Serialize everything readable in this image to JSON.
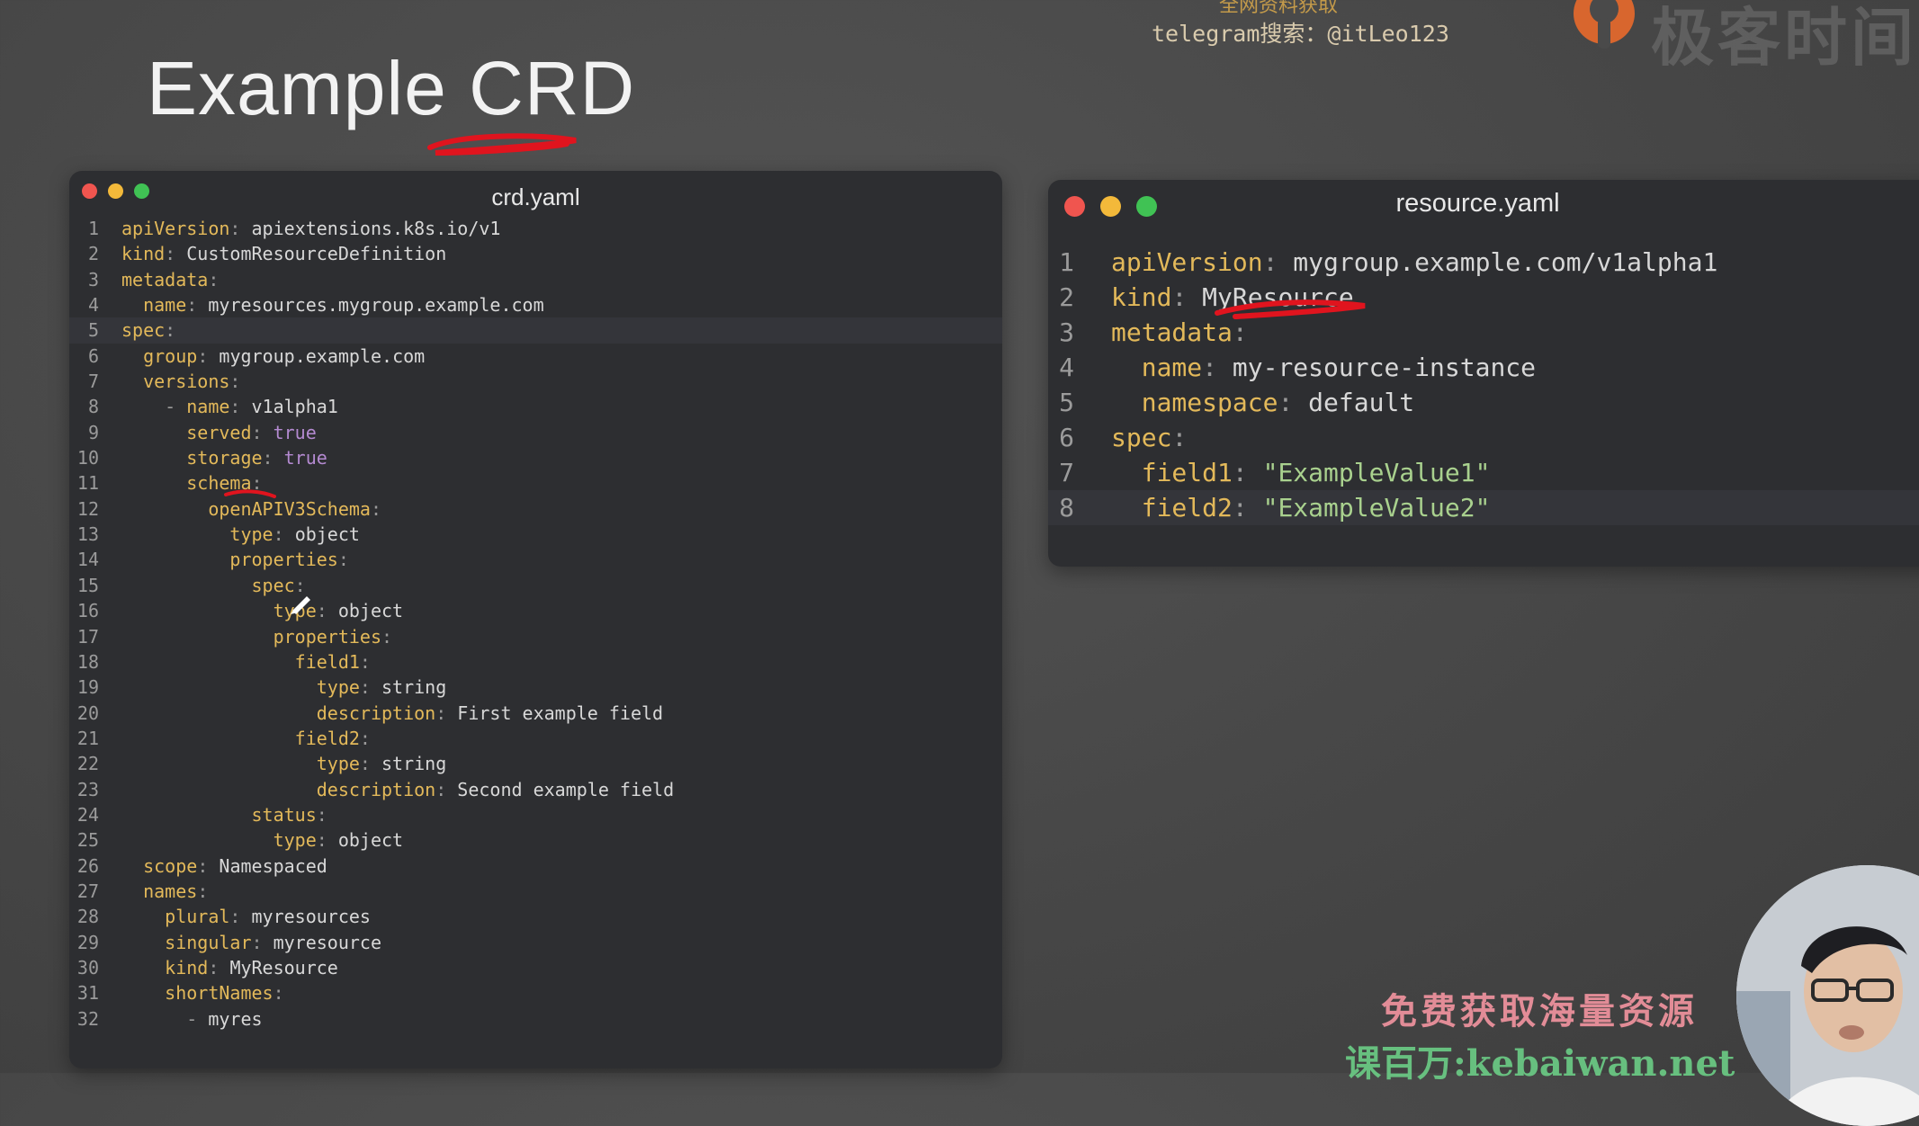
{
  "slide": {
    "title": "Example CRD"
  },
  "watermark": {
    "top_cut": "全网资料获取",
    "telegram": "telegram搜索：@itLeo123",
    "logo_text": "极客时间"
  },
  "left_window": {
    "title": "crd.yaml",
    "lines": [
      {
        "n": "1",
        "i": "",
        "k": "apiVersion",
        "v": "apiextensions.k8s.io/v1",
        "t": "v"
      },
      {
        "n": "2",
        "i": "",
        "k": "kind",
        "v": "CustomResourceDefinition",
        "t": "v"
      },
      {
        "n": "3",
        "i": "",
        "k": "metadata",
        "v": "",
        "t": "v"
      },
      {
        "n": "4",
        "i": "  ",
        "k": "name",
        "v": "myresources.mygroup.example.com",
        "t": "v"
      },
      {
        "n": "5",
        "i": "",
        "k": "spec",
        "v": "",
        "t": "v",
        "hl": true
      },
      {
        "n": "6",
        "i": "  ",
        "k": "group",
        "v": "mygroup.example.com",
        "t": "v"
      },
      {
        "n": "7",
        "i": "  ",
        "k": "versions",
        "v": "",
        "t": "v"
      },
      {
        "n": "8",
        "i": "    - ",
        "k": "name",
        "v": "v1alpha1",
        "t": "v"
      },
      {
        "n": "9",
        "i": "      ",
        "k": "served",
        "v": "true",
        "t": "b"
      },
      {
        "n": "10",
        "i": "      ",
        "k": "storage",
        "v": "true",
        "t": "b"
      },
      {
        "n": "11",
        "i": "      ",
        "k": "schema",
        "v": "",
        "t": "v"
      },
      {
        "n": "12",
        "i": "        ",
        "k": "openAPIV3Schema",
        "v": "",
        "t": "v"
      },
      {
        "n": "13",
        "i": "          ",
        "k": "type",
        "v": "object",
        "t": "v"
      },
      {
        "n": "14",
        "i": "          ",
        "k": "properties",
        "v": "",
        "t": "v"
      },
      {
        "n": "15",
        "i": "            ",
        "k": "spec",
        "v": "",
        "t": "v"
      },
      {
        "n": "16",
        "i": "              ",
        "k": "type",
        "v": "object",
        "t": "v"
      },
      {
        "n": "17",
        "i": "              ",
        "k": "properties",
        "v": "",
        "t": "v"
      },
      {
        "n": "18",
        "i": "                ",
        "k": "field1",
        "v": "",
        "t": "v"
      },
      {
        "n": "19",
        "i": "                  ",
        "k": "type",
        "v": "string",
        "t": "v"
      },
      {
        "n": "20",
        "i": "                  ",
        "k": "description",
        "v": "First example field",
        "t": "v"
      },
      {
        "n": "21",
        "i": "                ",
        "k": "field2",
        "v": "",
        "t": "v"
      },
      {
        "n": "22",
        "i": "                  ",
        "k": "type",
        "v": "string",
        "t": "v"
      },
      {
        "n": "23",
        "i": "                  ",
        "k": "description",
        "v": "Second example field",
        "t": "v"
      },
      {
        "n": "24",
        "i": "            ",
        "k": "status",
        "v": "",
        "t": "v"
      },
      {
        "n": "25",
        "i": "              ",
        "k": "type",
        "v": "object",
        "t": "v"
      },
      {
        "n": "26",
        "i": "  ",
        "k": "scope",
        "v": "Namespaced",
        "t": "v"
      },
      {
        "n": "27",
        "i": "  ",
        "k": "names",
        "v": "",
        "t": "v"
      },
      {
        "n": "28",
        "i": "    ",
        "k": "plural",
        "v": "myresources",
        "t": "v"
      },
      {
        "n": "29",
        "i": "    ",
        "k": "singular",
        "v": "myresource",
        "t": "v"
      },
      {
        "n": "30",
        "i": "    ",
        "k": "kind",
        "v": "MyResource",
        "t": "v"
      },
      {
        "n": "31",
        "i": "    ",
        "k": "shortNames",
        "v": "",
        "t": "v"
      },
      {
        "n": "32",
        "i": "      - ",
        "k": "",
        "v": "myres",
        "t": "v"
      }
    ]
  },
  "right_window": {
    "title": "resource.yaml",
    "lines": [
      {
        "n": "1",
        "i": "",
        "k": "apiVersion",
        "v": "mygroup.example.com/v1alpha1",
        "t": "v"
      },
      {
        "n": "2",
        "i": "",
        "k": "kind",
        "v": "MyResource",
        "t": "v"
      },
      {
        "n": "3",
        "i": "",
        "k": "metadata",
        "v": "",
        "t": "v"
      },
      {
        "n": "4",
        "i": "  ",
        "k": "name",
        "v": "my-resource-instance",
        "t": "v"
      },
      {
        "n": "5",
        "i": "  ",
        "k": "namespace",
        "v": "default",
        "t": "v"
      },
      {
        "n": "6",
        "i": "",
        "k": "spec",
        "v": "",
        "t": "v"
      },
      {
        "n": "7",
        "i": "  ",
        "k": "field1",
        "v": "\"ExampleValue1\"",
        "t": "s"
      },
      {
        "n": "8",
        "i": "  ",
        "k": "field2",
        "v": "\"ExampleValue2\"",
        "t": "s",
        "hl": true
      }
    ]
  },
  "promo": {
    "line1": "免费获取海量资源",
    "line2": "课百万:kebaiwan.net"
  },
  "colors": {
    "key": "#e3b95a",
    "bool": "#b48ad1",
    "string": "#a9d18e",
    "annotation": "#e0141e"
  }
}
